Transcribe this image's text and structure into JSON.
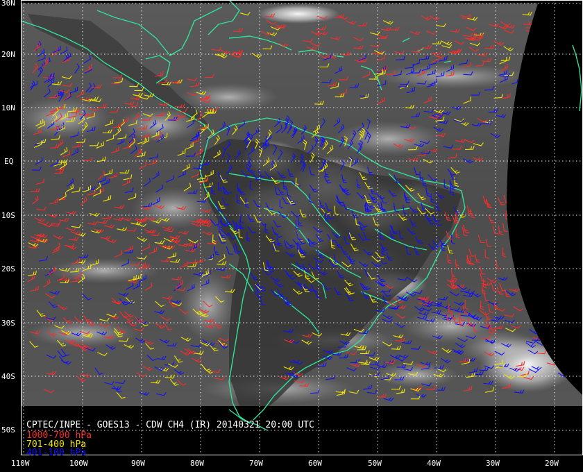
{
  "title": "CPTEC/INPE - GOES13 - CDW CH4 (IR) 20140321 20:00 UTC",
  "legend": [
    {
      "label": "1000-700 hPa",
      "color": "#ff2a2a"
    },
    {
      "label": "701-400 hPa",
      "color": "#f2e600"
    },
    {
      "label": "401-100 hPa",
      "color": "#1010ff"
    }
  ],
  "colors": {
    "background": "#000000",
    "coastline": "#2fe39a",
    "grid": "#ffffff"
  },
  "lat_labels": [
    "30N",
    "20N",
    "10N",
    "EQ",
    "10S",
    "20S",
    "30S",
    "40S",
    "50S"
  ],
  "lon_labels": [
    "110W",
    "100W",
    "90W",
    "80W",
    "70W",
    "60W",
    "50W",
    "40W",
    "30W",
    "20W"
  ]
}
